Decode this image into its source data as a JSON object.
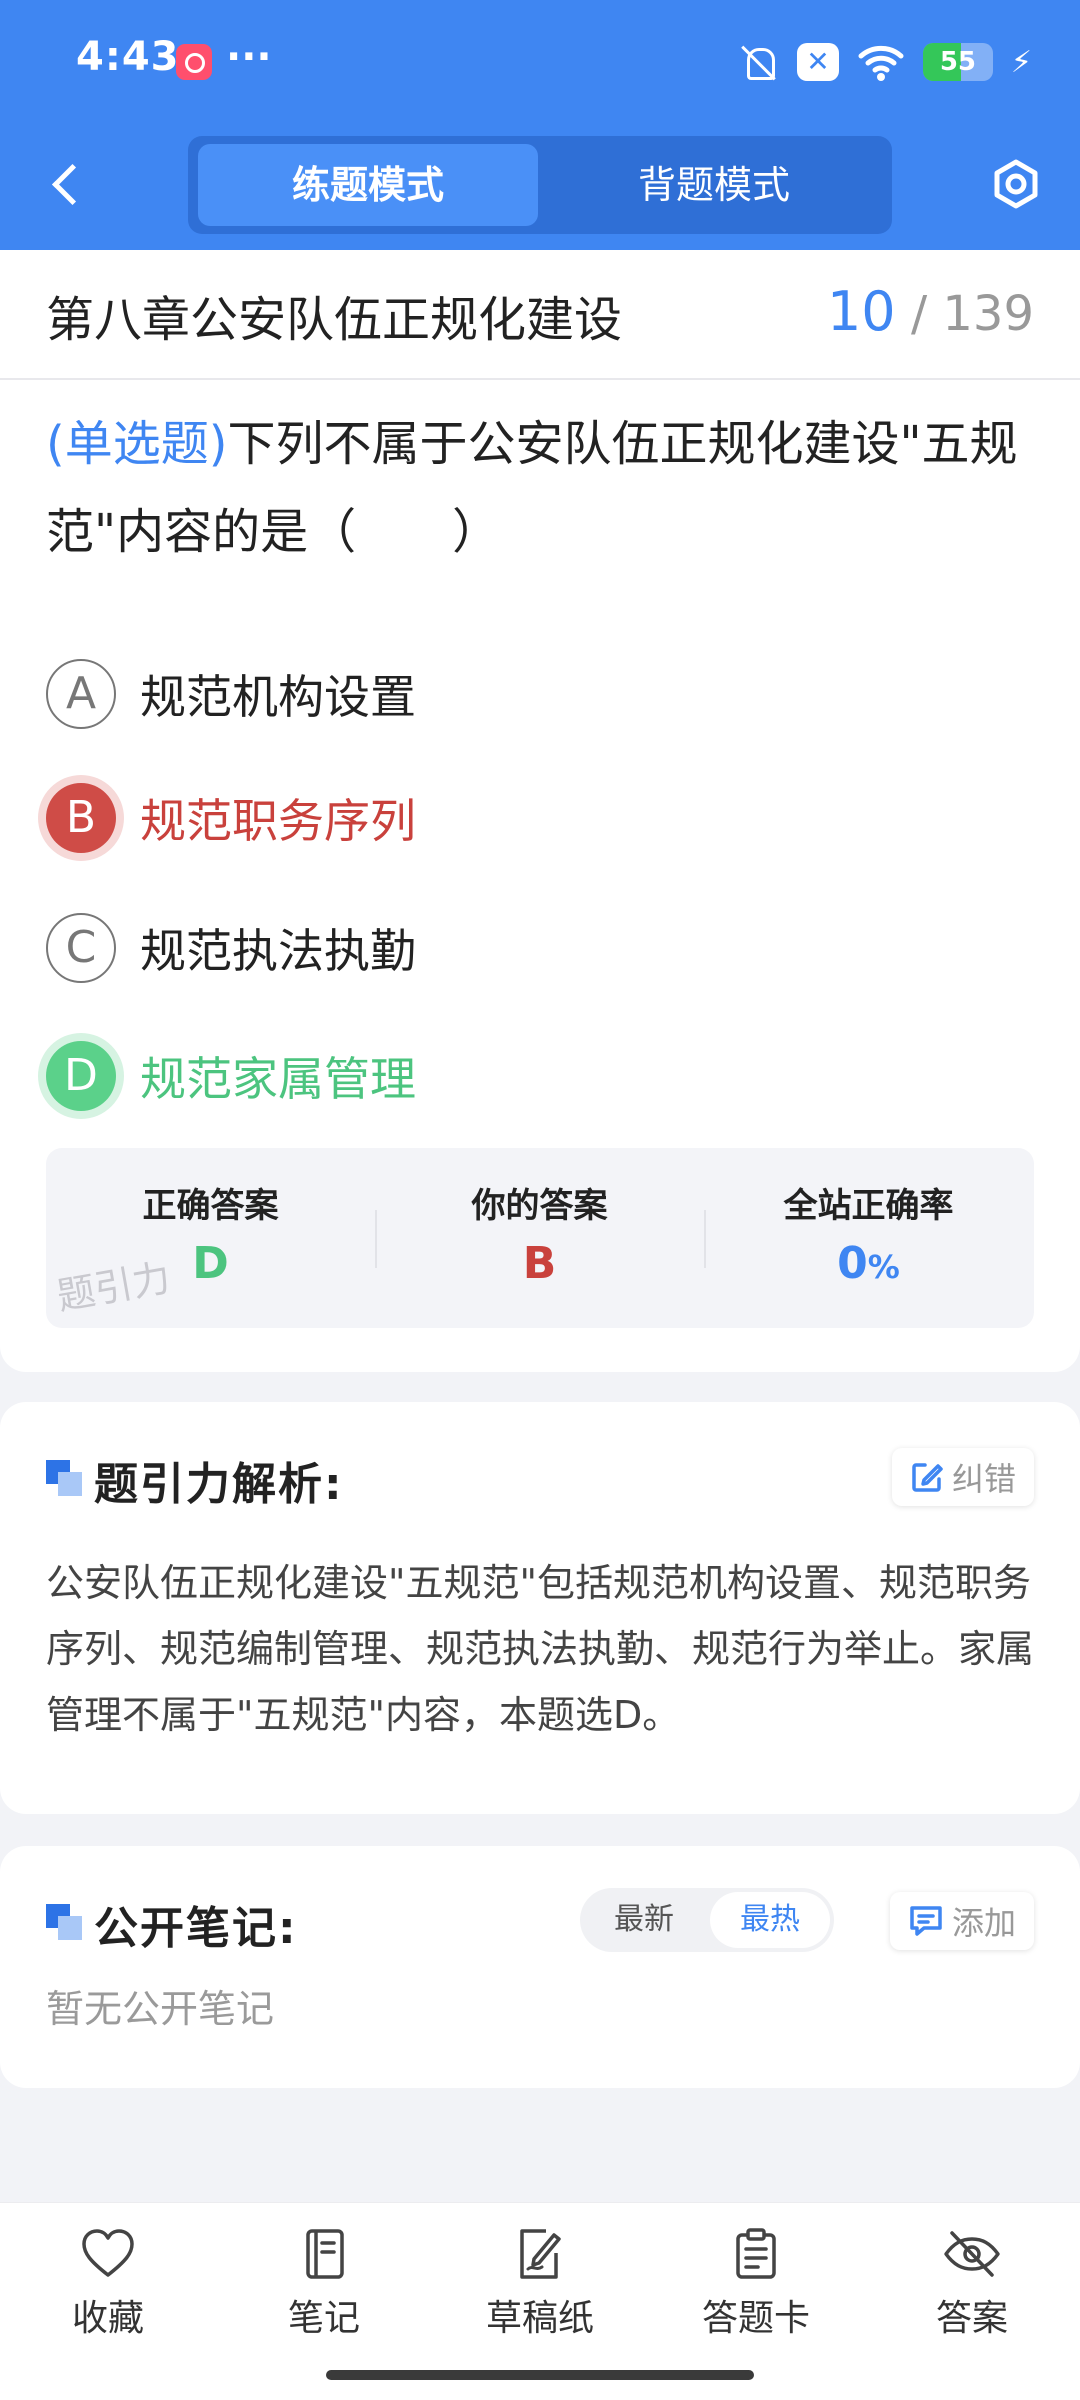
{
  "status_bar": {
    "time": "4:43",
    "battery": "55",
    "battery_level": 0.55
  },
  "header": {
    "tabs": [
      {
        "label": "练题模式",
        "active": true
      },
      {
        "label": "背题模式",
        "active": false
      }
    ]
  },
  "chapter": {
    "title": "第八章公安队伍正规化建设",
    "current": "10",
    "total": "139",
    "separator": "/"
  },
  "question": {
    "type_label": "(单选题)",
    "text": "下列不属于公安队伍正规化建设\"五规范\"内容的是（　　）",
    "options": [
      {
        "letter": "A",
        "text": "规范机构设置",
        "state": "normal"
      },
      {
        "letter": "B",
        "text": "规范职务序列",
        "state": "wrong"
      },
      {
        "letter": "C",
        "text": "规范执法执勤",
        "state": "normal"
      },
      {
        "letter": "D",
        "text": "规范家属管理",
        "state": "correct"
      }
    ]
  },
  "result": {
    "correct_label": "正确答案",
    "correct_value": "D",
    "yours_label": "你的答案",
    "yours_value": "B",
    "rate_label": "全站正确率",
    "rate_value": "0",
    "rate_unit": "%",
    "watermark": "题引力"
  },
  "analysis": {
    "title": "题引力解析:",
    "report_label": "纠错",
    "text": "公安队伍正规化建设\"五规范\"包括规范机构设置、规范职务序列、规范编制管理、规范执法执勤、规范行为举止。家属管理不属于\"五规范\"内容，本题选D。"
  },
  "notes": {
    "title": "公开笔记:",
    "sort_latest": "最新",
    "sort_hot": "最热",
    "add_label": "添加",
    "empty_text": "暂无公开笔记"
  },
  "toolbar": {
    "items": [
      {
        "label": "收藏",
        "icon": "heart-icon"
      },
      {
        "label": "笔记",
        "icon": "notebook-icon"
      },
      {
        "label": "草稿纸",
        "icon": "draft-icon"
      },
      {
        "label": "答题卡",
        "icon": "answer-card-icon"
      },
      {
        "label": "答案",
        "icon": "eye-off-icon"
      }
    ]
  },
  "colors": {
    "primary": "#3f86f2",
    "wrong": "#c9413c",
    "correct": "#4cc47f"
  }
}
